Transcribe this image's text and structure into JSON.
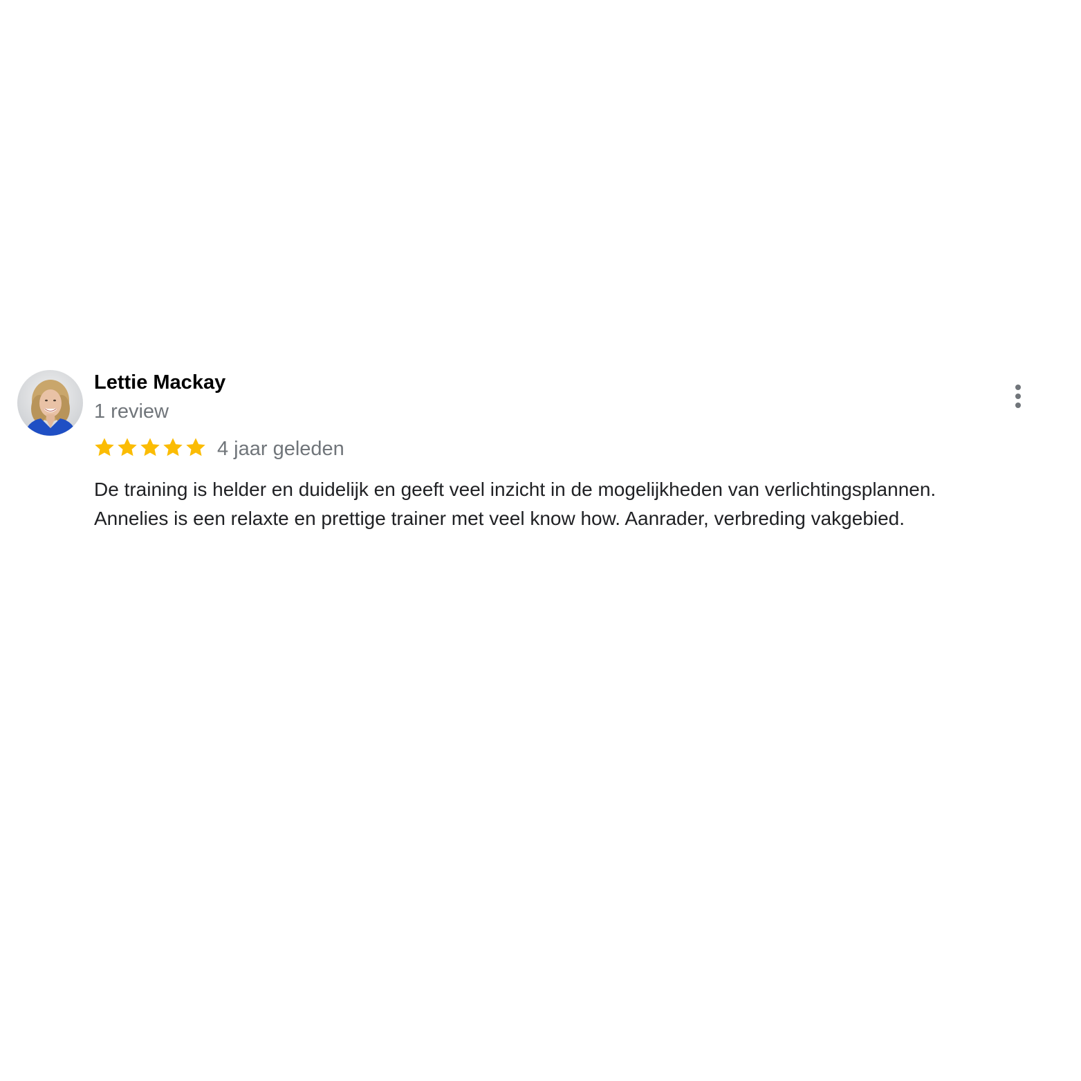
{
  "review": {
    "author": {
      "name": "Lettie Mackay",
      "review_count": "1 review",
      "avatar": "avatar-photo"
    },
    "rating": {
      "value": 5,
      "max": 5,
      "star_color": "#fbbc04",
      "icon": "star-icon"
    },
    "date": "4 jaar geleden",
    "text_lines": [
      "De training is helder en duidelijk en geeft veel inzicht in de mogelijkheden van verlichtingsplannen.",
      "Annelies is een relaxte en prettige trainer met veel know how. Aanrader, verbreding vakgebied."
    ],
    "menu_icon": "more-vert-icon"
  },
  "colors": {
    "name": "#000000",
    "secondary": "#70757a",
    "body_text": "#202124",
    "background": "#ffffff"
  }
}
